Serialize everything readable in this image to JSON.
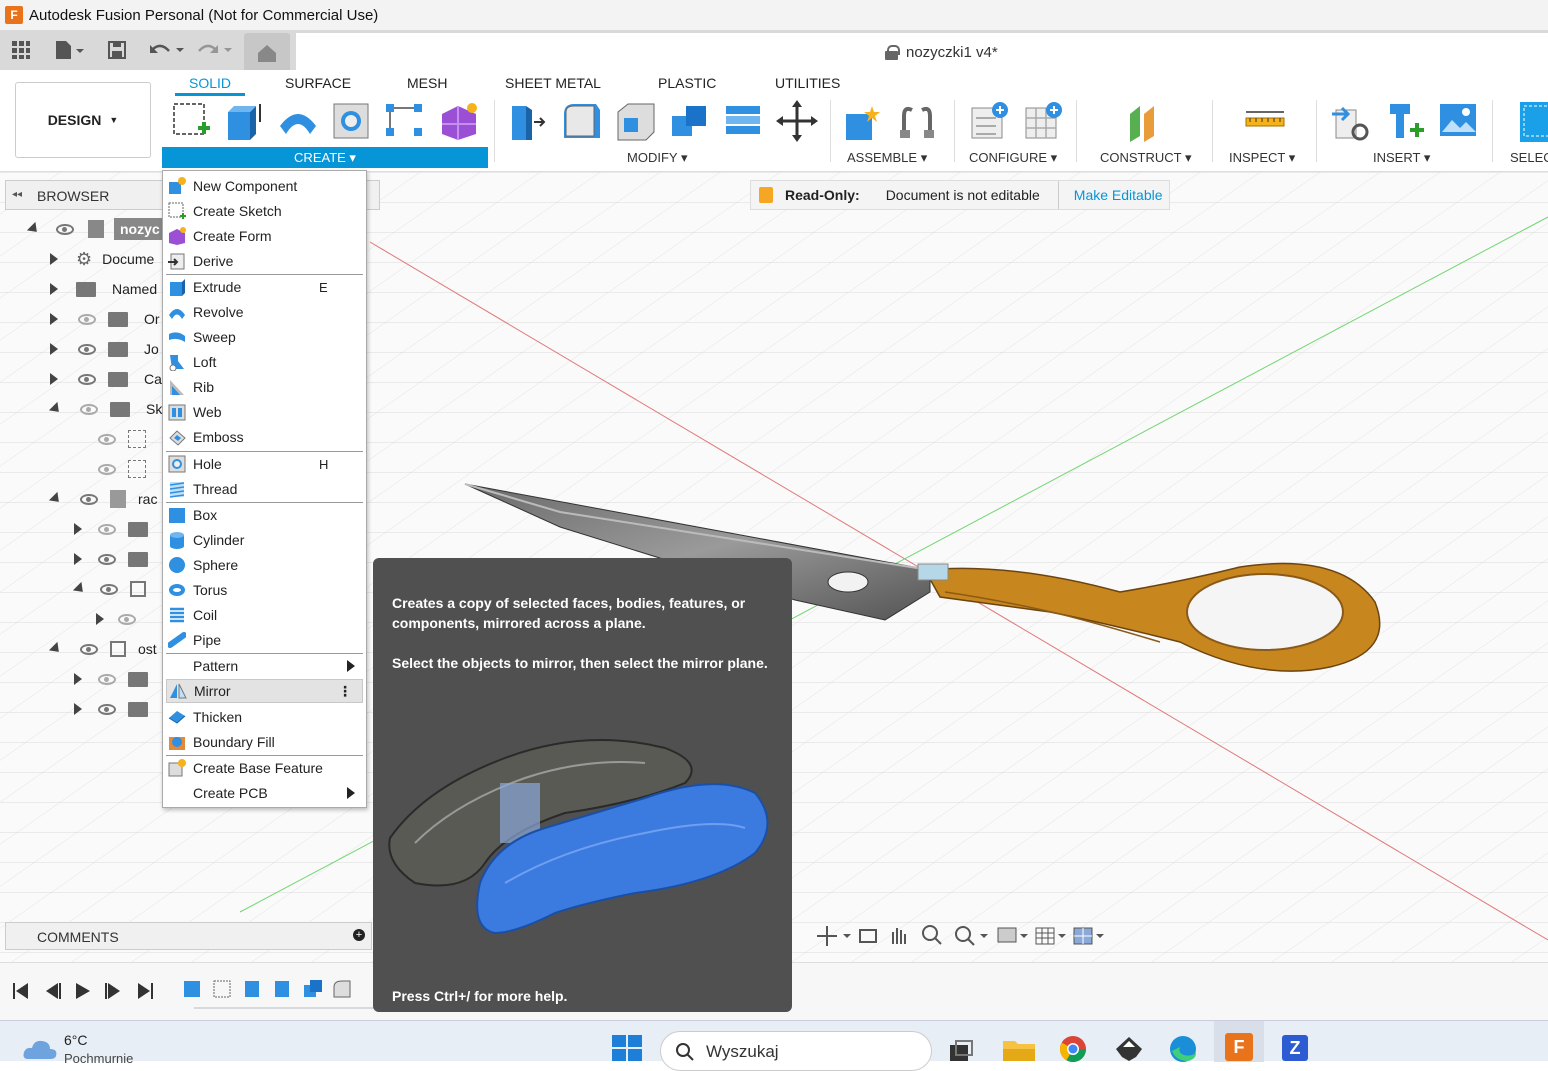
{
  "window": {
    "title": "Autodesk Fusion Personal (Not for Commercial Use)",
    "logo_letter": "F"
  },
  "document": {
    "title": "nozyczki1 v4*"
  },
  "workspace": {
    "label": "DESIGN"
  },
  "tabs": [
    "SOLID",
    "SURFACE",
    "MESH",
    "SHEET METAL",
    "PLASTIC",
    "UTILITIES"
  ],
  "groups": {
    "create": "CREATE",
    "modify": "MODIFY",
    "assemble": "ASSEMBLE",
    "configure": "CONFIGURE",
    "construct": "CONSTRUCT",
    "inspect": "INSPECT",
    "insert": "INSERT",
    "select": "SELEC"
  },
  "browser": {
    "title": "BROWSER",
    "rows": [
      "nozyc",
      "Docume",
      "Named",
      "Or",
      "Jo",
      "Ca",
      "Sk",
      "rac",
      "ost"
    ]
  },
  "readonly": {
    "label": "Read-Only:",
    "message": "Document is not editable",
    "action": "Make Editable"
  },
  "menu": {
    "items": [
      {
        "label": "New Component",
        "shortcut": ""
      },
      {
        "label": "Create Sketch",
        "shortcut": ""
      },
      {
        "label": "Create Form",
        "shortcut": ""
      },
      {
        "label": "Derive",
        "shortcut": ""
      },
      {
        "label": "Extrude",
        "shortcut": "E"
      },
      {
        "label": "Revolve",
        "shortcut": ""
      },
      {
        "label": "Sweep",
        "shortcut": ""
      },
      {
        "label": "Loft",
        "shortcut": ""
      },
      {
        "label": "Rib",
        "shortcut": ""
      },
      {
        "label": "Web",
        "shortcut": ""
      },
      {
        "label": "Emboss",
        "shortcut": ""
      },
      {
        "label": "Hole",
        "shortcut": "H"
      },
      {
        "label": "Thread",
        "shortcut": ""
      },
      {
        "label": "Box",
        "shortcut": ""
      },
      {
        "label": "Cylinder",
        "shortcut": ""
      },
      {
        "label": "Sphere",
        "shortcut": ""
      },
      {
        "label": "Torus",
        "shortcut": ""
      },
      {
        "label": "Coil",
        "shortcut": ""
      },
      {
        "label": "Pipe",
        "shortcut": ""
      },
      {
        "label": "Pattern",
        "shortcut": ""
      },
      {
        "label": "Mirror",
        "shortcut": ""
      },
      {
        "label": "Thicken",
        "shortcut": ""
      },
      {
        "label": "Boundary Fill",
        "shortcut": ""
      },
      {
        "label": "Create Base Feature",
        "shortcut": ""
      },
      {
        "label": "Create PCB",
        "shortcut": ""
      }
    ]
  },
  "tooltip": {
    "p1": "Creates a copy of selected faces, bodies, features, or components, mirrored across a plane.",
    "p2": "Select the objects to mirror, then select the mirror plane.",
    "help": "Press Ctrl+/ for more help."
  },
  "comments": {
    "title": "COMMENTS"
  },
  "taskbar": {
    "temp": "6°C",
    "weather": "Pochmurnie",
    "search": "Wyszukaj"
  },
  "colors": {
    "accent": "#0696d7",
    "handle": "#c8861e",
    "tooltip_bg": "#505050"
  }
}
